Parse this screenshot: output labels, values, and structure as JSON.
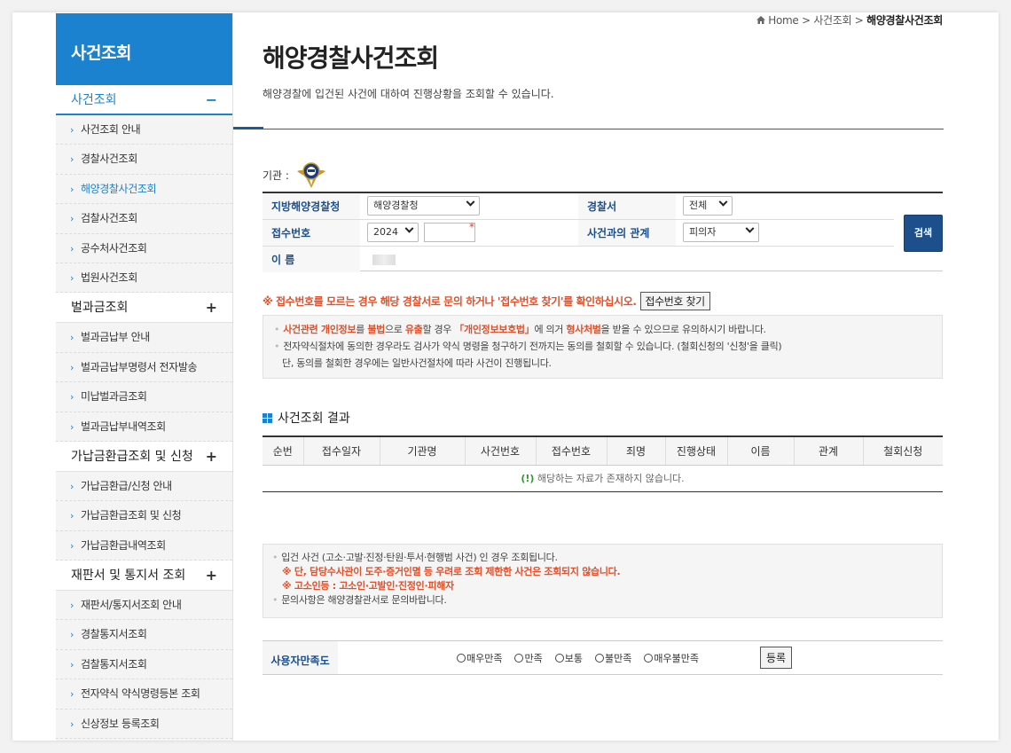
{
  "sidebar": {
    "title": "사건조회",
    "groups": [
      {
        "label": "사건조회",
        "toggle": "−",
        "items": [
          "사건조회 안내",
          "경찰사건조회",
          "해양경찰사건조회",
          "검찰사건조회",
          "공수처사건조회",
          "법원사건조회"
        ]
      },
      {
        "label": "벌과금조회",
        "toggle": "+",
        "items": [
          "벌과금납부 안내",
          "벌과금납부명령서 전자발송",
          "미납벌과금조회",
          "벌과금납부내역조회"
        ]
      },
      {
        "label": "가납금환급조회 및 신청",
        "toggle": "+",
        "items": [
          "가납금환급/신청 안내",
          "가납금환급조회 및 신청",
          "가납금환급내역조회"
        ]
      },
      {
        "label": "재판서 및 통지서 조회",
        "toggle": "+",
        "items": [
          "재판서/통지서조회 안내",
          "경찰통지서조회",
          "검찰통지서조회",
          "전자약식 약식명령등본 조회",
          "신상정보 등록조회"
        ]
      }
    ]
  },
  "breadcrumb": {
    "home": "Home",
    "sep": ">",
    "level1": "사건조회",
    "current": "해양경찰사건조회"
  },
  "page": {
    "title": "해양경찰사건조회",
    "description": "해양경찰에 입건된 사건에 대하여 진행상황을 조회할 수 있습니다."
  },
  "agency_label": "기관 :",
  "form": {
    "regional_label": "지방해양경찰청",
    "regional_value": "해양경찰청",
    "station_label": "경찰서",
    "station_value": "전체",
    "receipt_label": "접수번호",
    "year_value": "2024",
    "receipt_value": "",
    "required_mark": "*",
    "relation_label": "사건과의 관계",
    "relation_value": "피의자",
    "name_label": "이 름",
    "search_button": "검색"
  },
  "notice": {
    "text": "※ 접수번호를 모르는 경우 해당 경찰서로 문의 하거나 '접수번호 찾기'를 확인하십시오.",
    "find_button": "접수번호 찾기"
  },
  "info1": {
    "line1_a": "사건관련 개인정보",
    "line1_b": "를 ",
    "line1_c": "불법",
    "line1_d": "으로 ",
    "line1_e": "유출",
    "line1_f": "할 경우 ",
    "line1_g": "「개인정보보호법」",
    "line1_h": "에 의거 ",
    "line1_i": "형사처벌",
    "line1_j": "을 받을 수 있으므로 유의하시기 바랍니다.",
    "line2": "전자약식절차에 동의한 경우라도 검사가 약식 명령을 청구하기 전까지는 동의를 철회할 수 있습니다. (철회신청의 '신청'을 클릭)",
    "line3": "단, 동의를 철회한 경우에는 일반사건절차에 따라 사건이 진행됩니다."
  },
  "results": {
    "title": "사건조회 결과",
    "columns": [
      "순번",
      "접수일자",
      "기관명",
      "사건번호",
      "접수번호",
      "죄명",
      "진행상태",
      "이름",
      "관계",
      "철회신청"
    ],
    "empty_mark": "(!)",
    "empty_text": "해당하는 자료가 존재하지 않습니다."
  },
  "info2": {
    "line1": "입건 사건 (고소·고발·진정·탄원·투서·현행범 사건) 인 경우 조회됩니다.",
    "line2": "※ 단, 담당수사관이 도주·증거인멸 등 우려로 조회 제한한 사건은 조회되지 않습니다.",
    "line3": "※ 고소인등 : 고소인·고발인·진정인·피해자",
    "line4": "문의사항은 해양경찰관서로 문의바랍니다."
  },
  "satisfaction": {
    "label": "사용자만족도",
    "options": [
      "매우만족",
      "만족",
      "보통",
      "불만족",
      "매우불만족"
    ],
    "submit": "등록"
  }
}
